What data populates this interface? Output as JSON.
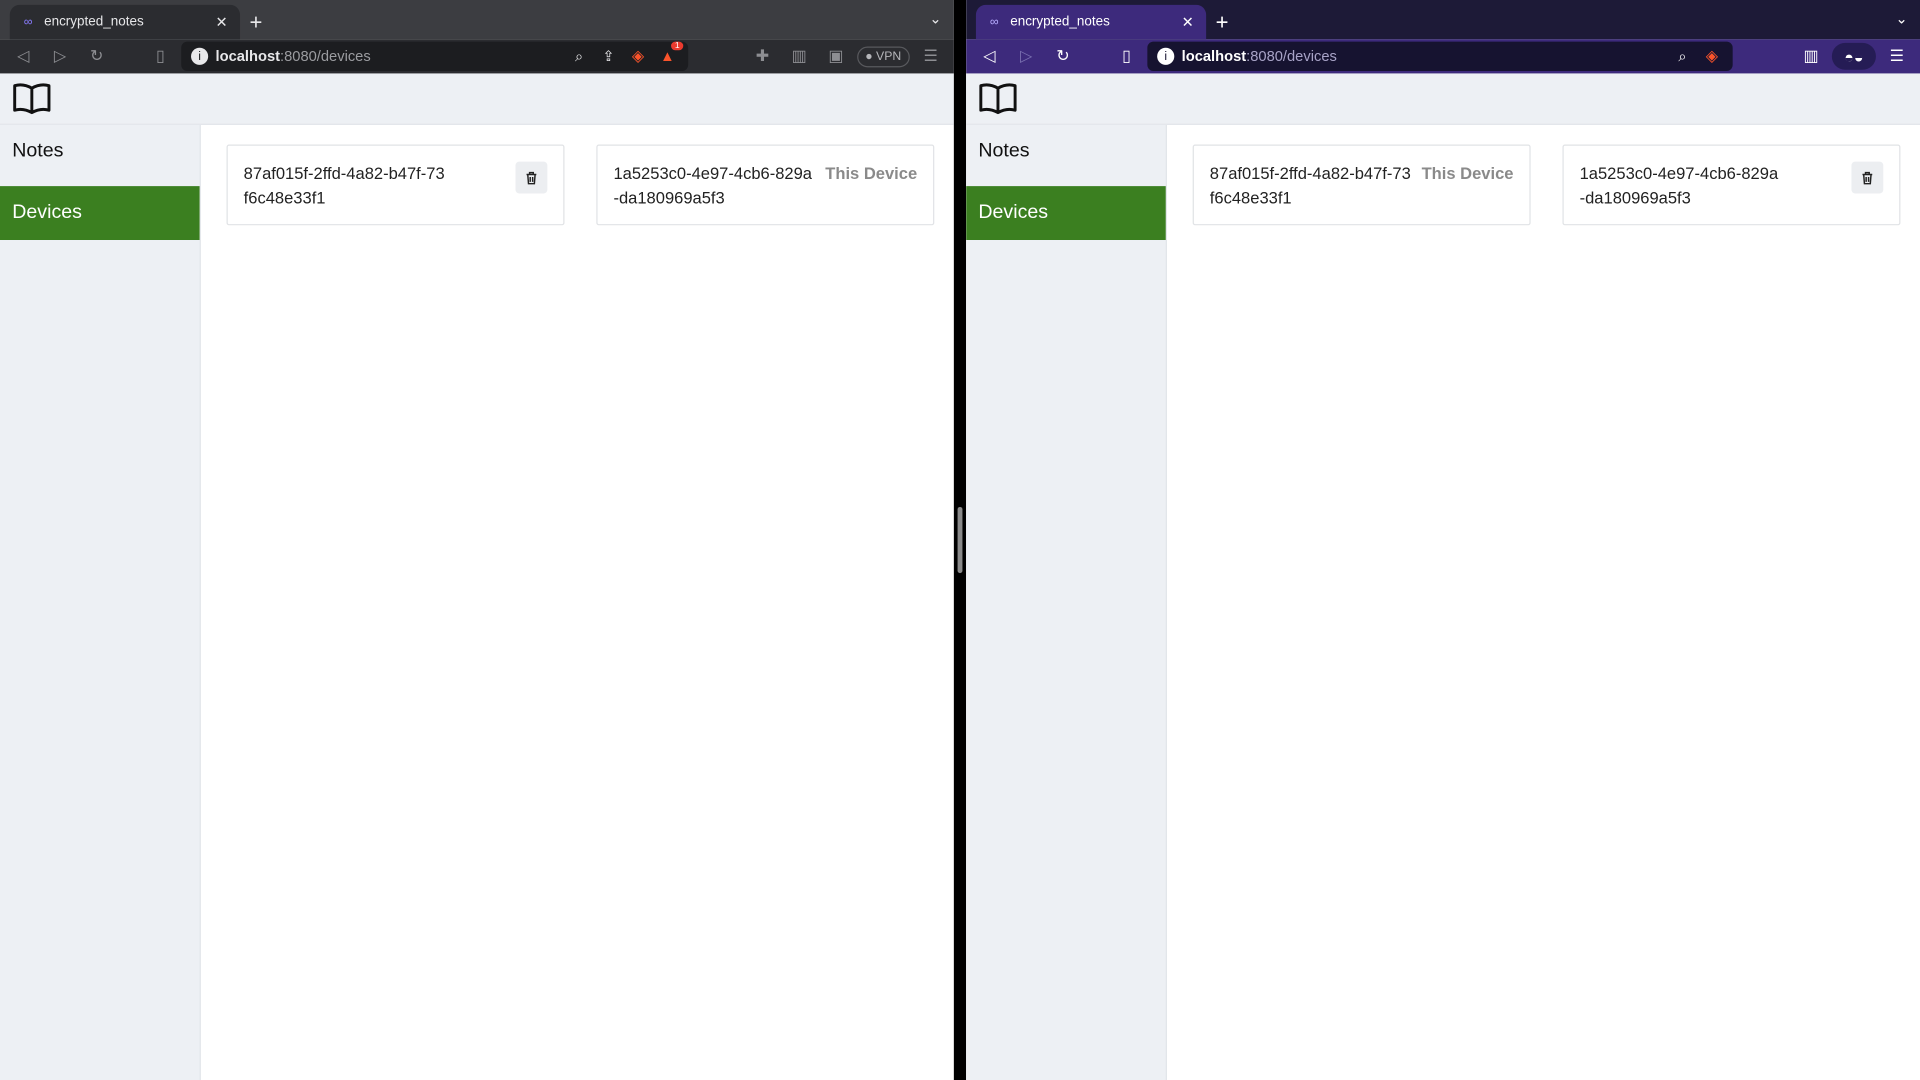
{
  "windows": {
    "left": {
      "tab_title": "encrypted_notes",
      "url_host": "localhost",
      "url_rest": ":8080/devices",
      "vpn_label": "VPN",
      "alert_count": "1",
      "app": {
        "nav": [
          "Notes",
          "Devices"
        ],
        "active_nav": "Devices",
        "devices": [
          {
            "id": "87af015f-2ffd-4a82-b47f-73f6c48e33f1",
            "label": "",
            "action": "delete"
          },
          {
            "id": "1a5253c0-4e97-4cb6-829a-da180969a5f3",
            "label": "This Device",
            "action": ""
          }
        ]
      }
    },
    "right": {
      "tab_title": "encrypted_notes",
      "url_host": "localhost",
      "url_rest": ":8080/devices",
      "app": {
        "nav": [
          "Notes",
          "Devices"
        ],
        "active_nav": "Devices",
        "devices": [
          {
            "id": "87af015f-2ffd-4a82-b47f-73f6c48e33f1",
            "label": "This Device",
            "action": ""
          },
          {
            "id": "1a5253c0-4e97-4cb6-829a-da180969a5f3",
            "label": "",
            "action": "delete"
          }
        ]
      }
    }
  },
  "colors": {
    "active_nav": "#3b7f20",
    "left_chrome": "#2b2c30",
    "right_chrome": "#3d2a7c",
    "brave_orange": "#fb542b"
  },
  "icons": [
    "book-icon",
    "trash-icon",
    "lock-icon",
    "brave-lion-icon",
    "bookmark-icon",
    "zoom-icon",
    "share-icon",
    "extensions-icon",
    "sidebar-icon",
    "wallet-icon",
    "menu-icon",
    "leo-glasses-icon"
  ]
}
